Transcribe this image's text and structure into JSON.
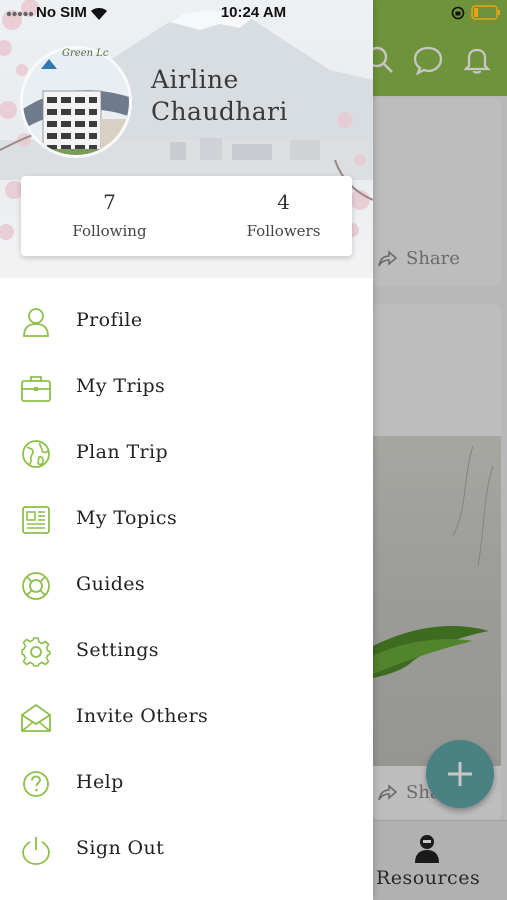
{
  "status_bar": {
    "carrier": "No SIM",
    "time": "10:24 AM"
  },
  "drawer": {
    "user": {
      "name": "Airline Chaudhari",
      "avatar_caption": "Green Lc"
    },
    "stats": {
      "following_count": "7",
      "following_label": "Following",
      "followers_count": "4",
      "followers_label": "Followers"
    },
    "menu": [
      {
        "label": "Profile",
        "icon": "person-icon"
      },
      {
        "label": "My Trips",
        "icon": "briefcase-icon"
      },
      {
        "label": "Plan Trip",
        "icon": "globe-icon"
      },
      {
        "label": "My Topics",
        "icon": "newspaper-icon"
      },
      {
        "label": "Guides",
        "icon": "lifebuoy-icon"
      },
      {
        "label": "Settings",
        "icon": "gear-icon"
      },
      {
        "label": "Invite Others",
        "icon": "envelope-open-icon"
      },
      {
        "label": "Help",
        "icon": "question-circle-icon"
      },
      {
        "label": "Sign Out",
        "icon": "power-icon"
      }
    ]
  },
  "background": {
    "share_label": "Share",
    "share_label_partial": "Sha",
    "bottom_tab_label": "Resources"
  },
  "colors": {
    "accent_green": "#8ebd4c",
    "icon_green": "#8dbf4a",
    "fab_teal": "#5fa6a8"
  }
}
